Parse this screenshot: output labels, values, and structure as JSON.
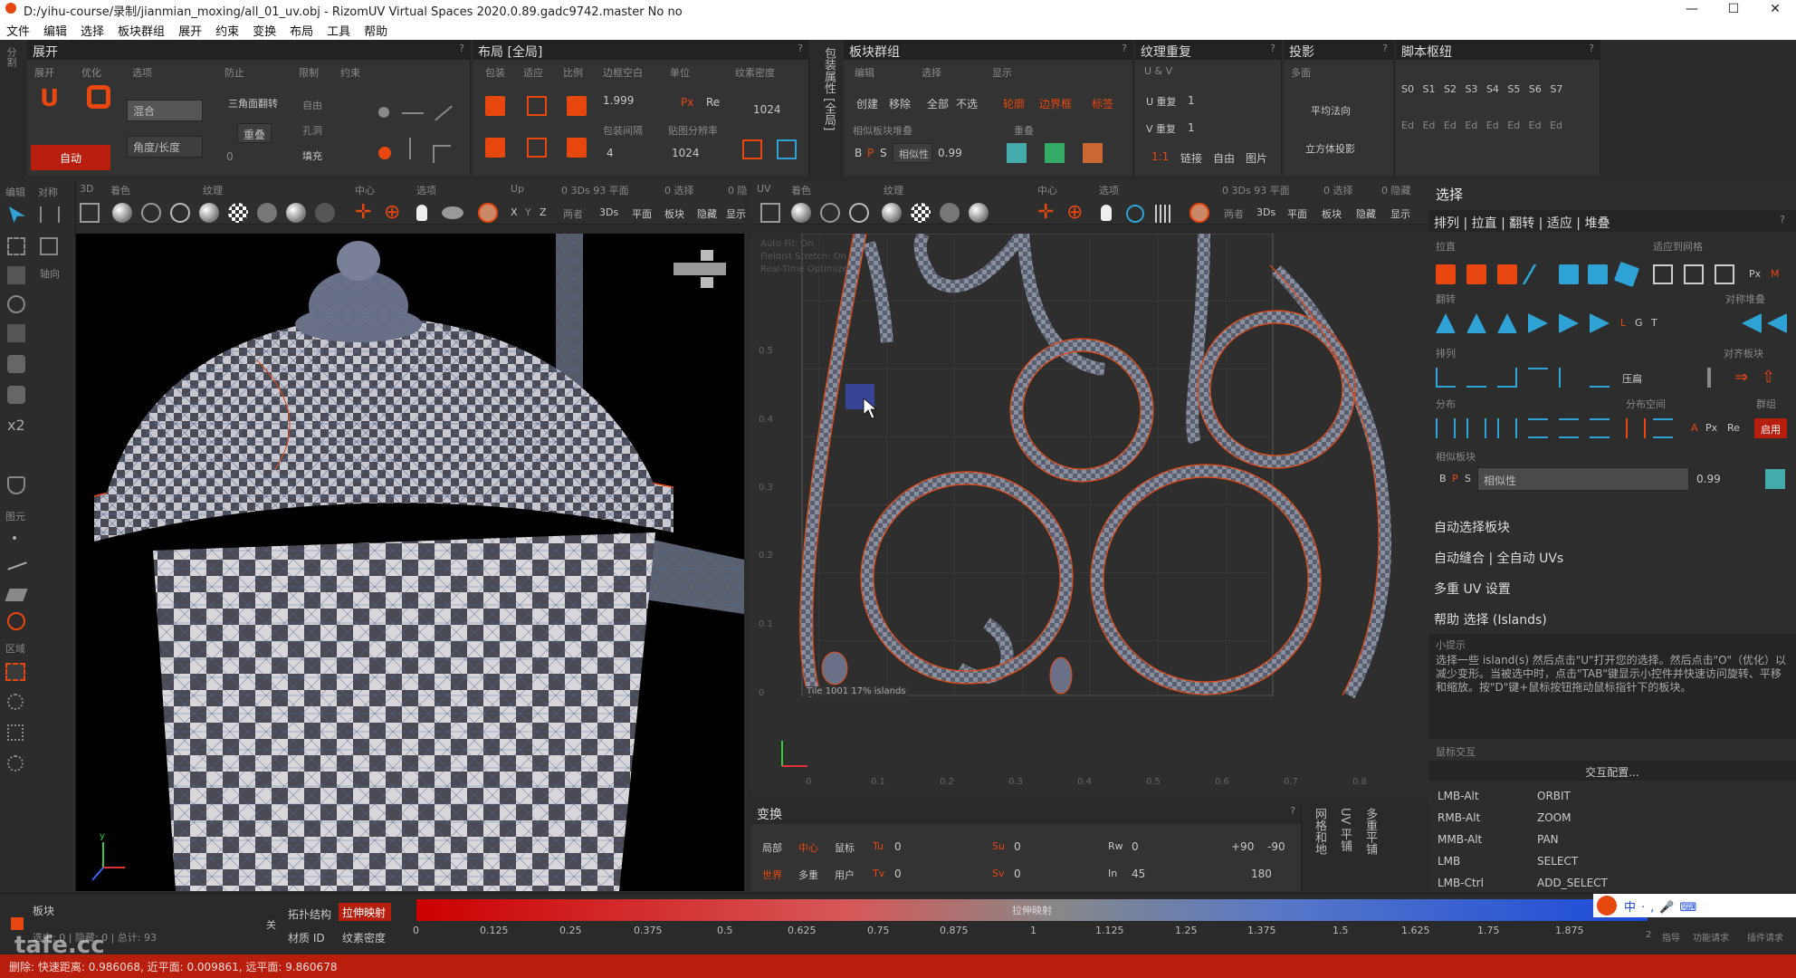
{
  "window": {
    "title": "D:/yihu-course/录制/jianmian_moxing/all_01_uv.obj - RizomUV  Virtual Spaces 2020.0.89.gadc9742.master No no",
    "minimize": "—",
    "maximize": "☐",
    "close": "✕"
  },
  "menu": [
    "文件",
    "编辑",
    "选择",
    "板块群组",
    "展开",
    "约束",
    "变换",
    "布局",
    "工具",
    "帮助"
  ],
  "left_strip": {
    "top": "分割",
    "labels": [
      "编辑",
      "对称",
      "轴向",
      "图元",
      "区域"
    ]
  },
  "unfold": {
    "title": "展开",
    "q": "?",
    "subs": [
      "展开",
      "优化",
      "选项",
      "防止",
      "限制",
      "约束"
    ],
    "auto": "自动",
    "mix": "混合",
    "angle_len": "角度/长度",
    "flip": "三角面翻转",
    "overlap": "重叠",
    "free": "自由",
    "holes": "孔洞",
    "fill": "填充",
    "zero": "0"
  },
  "layout": {
    "title": "布局 [全局]",
    "q": "?",
    "subs": [
      "包装",
      "适应",
      "比例",
      "边框空白",
      "单位",
      "纹素密度"
    ],
    "pack_spacing": "包装间隔",
    "tile_res": "贴图分辨率",
    "v1": "1.999",
    "px": "Px",
    "re": "Re",
    "v2": "1024",
    "v3": "4",
    "v4": "1024",
    "side": "包装属性 [全局]"
  },
  "groups": {
    "title": "板块群组",
    "q": "?",
    "subs": [
      "编辑",
      "选择",
      "显示"
    ],
    "create": "创建",
    "remove": "移除",
    "all": "全部",
    "none": "不选",
    "outline": "轮廓",
    "border": "边界框",
    "label": "标签",
    "stack": "相似板块堆叠",
    "overlap": "重叠",
    "b": "B",
    "p": "P",
    "s": "S",
    "similar": "相似性",
    "sim_val": "0.99"
  },
  "tiling": {
    "title": "纹理重复",
    "q": "?",
    "uv": "U & V",
    "u_label": "U 重复",
    "u_val": "1",
    "v_label": "V 重复",
    "v_val": "1",
    "ratio": "1:1",
    "link": "链接",
    "free": "自由",
    "image": "图片"
  },
  "projection": {
    "title": "投影",
    "q": "?",
    "multi": "多面",
    "normal": "平均法向",
    "cube": "立方体投影"
  },
  "script": {
    "title": "脚本枢纽",
    "q": "?",
    "slots": [
      "S0",
      "S1",
      "S2",
      "S3",
      "S4",
      "S5",
      "S6",
      "S7"
    ],
    "ed": "Ed"
  },
  "vp3d": {
    "row1": [
      "3D",
      "着色",
      "纹理",
      "中心",
      "选项",
      "Up",
      "0 3Ds 93 平面",
      "0 选择",
      "0 隐"
    ],
    "row2": [
      "X",
      "Y",
      "Z",
      "两者",
      "3Ds",
      "平面",
      "板块",
      "隐藏",
      "显示"
    ]
  },
  "vpuv": {
    "row1": [
      "UV",
      "着色",
      "纹理",
      "中心",
      "选项",
      "0 3Ds 93 平面",
      "0 选择",
      "0 隐藏"
    ],
    "row2": [
      "两者",
      "3Ds",
      "平面",
      "板块",
      "隐藏",
      "显示"
    ],
    "overlay": [
      "Auto Fit: On",
      "Fieldist Stretch: On",
      "Real-Time Optimize"
    ],
    "tile_info": "Tile 1001 17%  islands",
    "yticks": [
      "0.5",
      "0.4",
      "0.3",
      "0.2",
      "0.1",
      "0"
    ],
    "xticks": [
      "0",
      "0.1",
      "0.2",
      "0.3",
      "0.4",
      "0.5",
      "0.6",
      "0.7",
      "0.8"
    ]
  },
  "transform": {
    "title": "变换",
    "q": "?",
    "local": "局部",
    "center": "中心",
    "mouse": "鼠标",
    "world": "世界",
    "multi": "多重",
    "user": "用户",
    "tu": "Tu",
    "tv": "Tv",
    "su": "Su",
    "sv": "Sv",
    "rw": "Rw",
    "in": "In",
    "tu_val": "0",
    "tv_val": "0",
    "su_val": "0",
    "sv_val": "0",
    "rw_val": "0",
    "in_val": "45",
    "p90": "+90",
    "m90": "-90",
    "r180": "180",
    "side1": "网格和地",
    "side2": "UV 平铺",
    "side3": "多重平铺"
  },
  "select": {
    "title": "选择",
    "tabs": "排列 | 拉直 | 翻转 | 适应 | 堆叠",
    "q": "?",
    "straighten": "拉直",
    "fit_grid": "适应到网格",
    "flip": "翻转",
    "sym_stack": "对称堆叠",
    "arrange": "排列",
    "align": "对齐板块",
    "press": "压扁",
    "distribute": "分布",
    "dist_space": "分布空间",
    "group": "群组",
    "similar_label": "相似板块",
    "b": "B",
    "p": "P",
    "s": "S",
    "similar": "相似性",
    "sim_val": "0.99",
    "px": "Px",
    "m": "M",
    "l": "L",
    "g": "G",
    "t": "T",
    "a": "A",
    "re": "Re",
    "enable": "启用",
    "auto_select": "自动选择板块",
    "auto_seam": "自动缝合 | 全自动 UVs",
    "multi_uv": "多重 UV 设置",
    "help": "帮助 选择 (Islands)",
    "tip_title": "小提示",
    "tip": "选择一些 island(s) 然后点击\"U\"打开您的选择。然后点击\"O\"（优化）以减少变形。当被选中时，点击\"TAB\"键显示小控件并快速访问旋转、平移和缩放。按\"D\"键+鼠标按钮拖动鼠标指针下的板块。",
    "mouse_title": "鼠标交互",
    "config": "交互配置...",
    "keys": [
      [
        "LMB-Alt",
        "ORBIT"
      ],
      [
        "RMB-Alt",
        "ZOOM"
      ],
      [
        "MMB-Alt",
        "PAN"
      ],
      [
        "LMB",
        "SELECT"
      ],
      [
        "LMB-Ctrl",
        "ADD_SELECT"
      ]
    ]
  },
  "bottom": {
    "islands": "板块",
    "stats": "选中: 0 | 隐藏: 0 | 总计: 93",
    "off": "关",
    "topo": "拓扑结构",
    "stretch": "拉伸映射",
    "material": "材质 ID",
    "texel": "纹素密度",
    "bar_title": "拉伸映射",
    "scale": [
      "0",
      "0.125",
      "0.25",
      "0.375",
      "0.5",
      "0.625",
      "0.75",
      "0.875",
      "1",
      "1.125",
      "1.25",
      "1.375",
      "1.5",
      "1.625",
      "1.75",
      "1.875"
    ],
    "right": [
      "2",
      "指导",
      "功能请求",
      "插件请求"
    ]
  },
  "watermark": "tafe.cc",
  "status": "删除: 快速距离: 0.986068, 近平面: 0.009861, 远平面: 9.860678",
  "colors": {
    "accent": "#e8470f",
    "panel": "#333333",
    "dark": "#222222",
    "uvbg": "#2e2e2e"
  }
}
